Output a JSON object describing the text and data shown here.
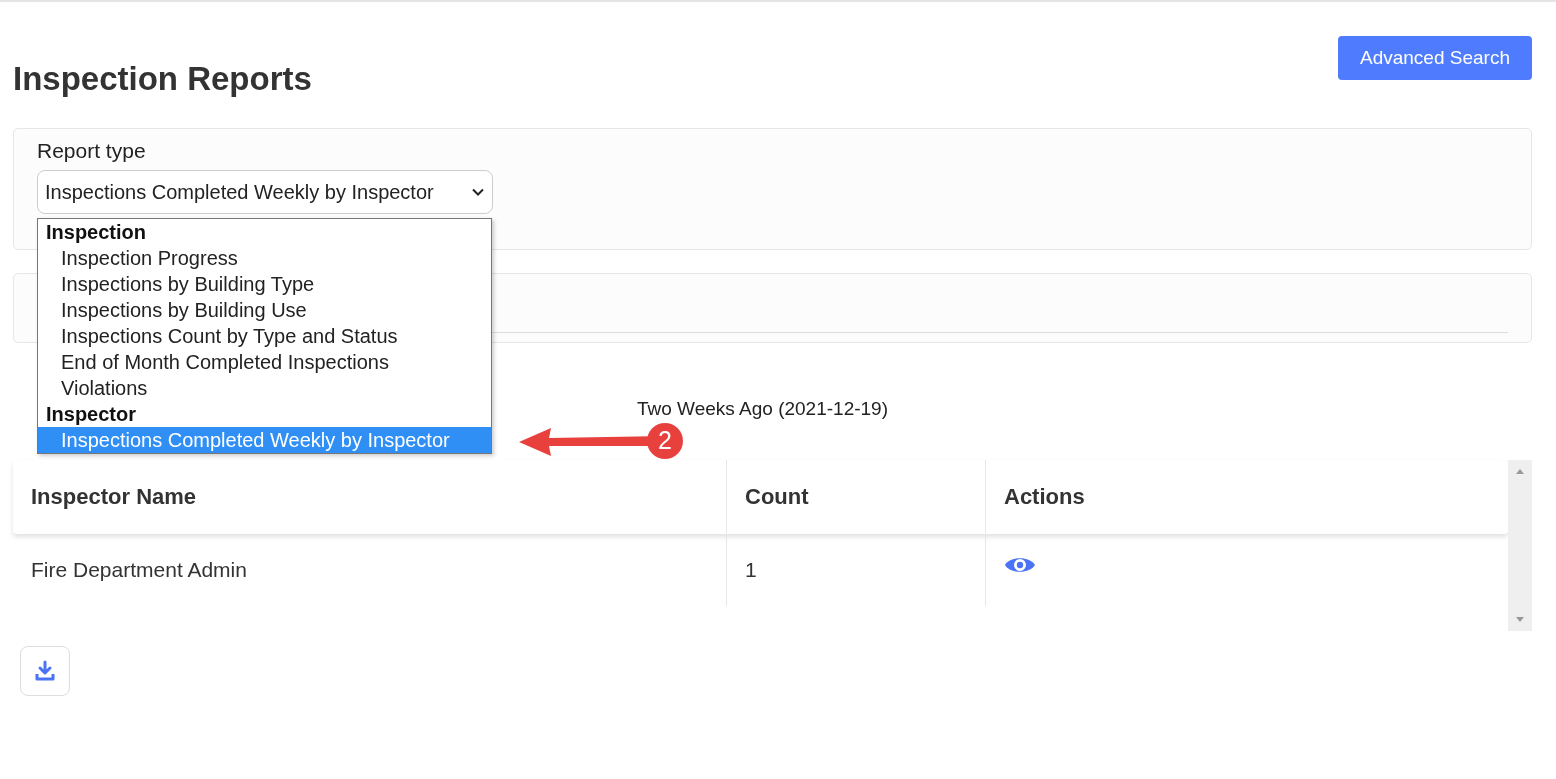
{
  "page_title": "Inspection Reports",
  "advanced_search_button": "Advanced Search",
  "report_type": {
    "label": "Report type",
    "value": "Inspections Completed Weekly by Inspector",
    "expanded": true,
    "groups": [
      {
        "label": "Inspection",
        "options": [
          {
            "label": "Inspection Progress",
            "selected": false
          },
          {
            "label": "Inspections by Building Type",
            "selected": false
          },
          {
            "label": "Inspections by Building Use",
            "selected": false
          },
          {
            "label": "Inspections Count by Type and Status",
            "selected": false
          },
          {
            "label": "End of Month Completed Inspections",
            "selected": false
          },
          {
            "label": "Violations",
            "selected": false
          }
        ]
      },
      {
        "label": "Inspector",
        "options": [
          {
            "label": "Inspections Completed Weekly by Inspector",
            "selected": true
          }
        ]
      }
    ]
  },
  "period_label": "Two Weeks Ago (2021-12-19)",
  "table": {
    "columns": [
      "Inspector Name",
      "Count",
      "Actions"
    ],
    "rows": [
      {
        "inspector_name": "Fire Department Admin",
        "count": "1"
      }
    ]
  },
  "annotation": {
    "number": "2"
  }
}
